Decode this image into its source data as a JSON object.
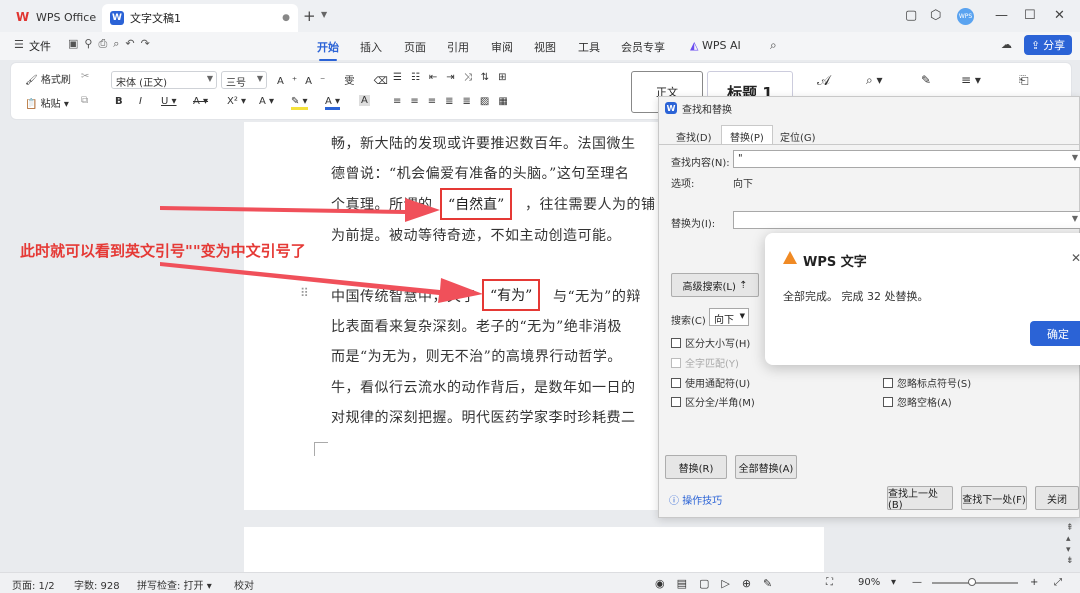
{
  "titlebar": {
    "app_name": "WPS Office",
    "doc_tab": "文字文稿1",
    "new_tab": "+",
    "avatar": "WPS"
  },
  "menubar": {
    "file": "文件",
    "tabs": [
      "开始",
      "插入",
      "页面",
      "引用",
      "审阅",
      "视图",
      "工具",
      "会员专享",
      "WPS AI"
    ],
    "active_tab": "开始",
    "share": "分享"
  },
  "ribbon": {
    "format_painter": "格式刷",
    "paste": "粘贴",
    "font_name": "宋体 (正文)",
    "font_size": "三号",
    "style_normal": "正文",
    "style_heading1": "标题 1"
  },
  "document": {
    "lines": [
      "畅，新大陆的发现或许要推迟数百年。法国微生",
      "德曾说：“机会偏爱有准备的头脑。”这句至理名",
      "个真理。所谓的",
      "，往往需要人为的铺",
      "为前提。被动等待奇迹，不如主动创造可能。",
      "中国传统智慧中，关于",
      "与“无为”的辩",
      "比表面看来复杂深刻。老子的“无为”绝非消极",
      "而是“为无为，则无不治”的高境界行动哲学。",
      "牛，看似行云流水的动作背后，是数年如一日的",
      "对规律的深刻把握。明代医药学家李时珍耗费二"
    ],
    "highlight_1": "“自然直”",
    "highlight_2": "“有为”",
    "annotation": "此时就可以看到英文引号\"\"变为中文引号了"
  },
  "find_dialog": {
    "title": "查找和替换",
    "tabs": [
      "查找(D)",
      "替换(P)",
      "定位(G)"
    ],
    "active_tab": "替换(P)",
    "find_label": "查找内容(N):",
    "find_value": "\"",
    "options_label": "选项:",
    "options_value": "向下",
    "replace_label": "替换为(I):",
    "replace_value": "",
    "advanced_button": "高级搜索(L)",
    "search_label": "搜索(C)",
    "search_direction": "向下",
    "checkboxes": {
      "match_case": "区分大小写(H)",
      "whole_word": "全字匹配(Y)",
      "wildcards": "使用通配符(U)",
      "full_half": "区分全/半角(M)",
      "ignore_punct": "忽略标点符号(S)",
      "ignore_space": "忽略空格(A)"
    },
    "replace_button": "替换(R)",
    "replace_all_button": "全部替换(A)",
    "tips_link": "操作技巧",
    "find_prev_button": "查找上一处(B)",
    "find_next_button": "查找下一处(F)",
    "close_button": "关闭"
  },
  "message_box": {
    "title": "WPS 文字",
    "message": "全部完成。 完成 32 处替换。",
    "ok": "确定"
  },
  "statusbar": {
    "page": "页面: 1/2",
    "word_count": "字数: 928",
    "spell_check": "拼写检查: 打开",
    "proofread": "校对",
    "zoom": "90%"
  },
  "colors": {
    "accent": "#2b63d6",
    "annotation_red": "#e53935",
    "wps_red": "#e0342f"
  }
}
